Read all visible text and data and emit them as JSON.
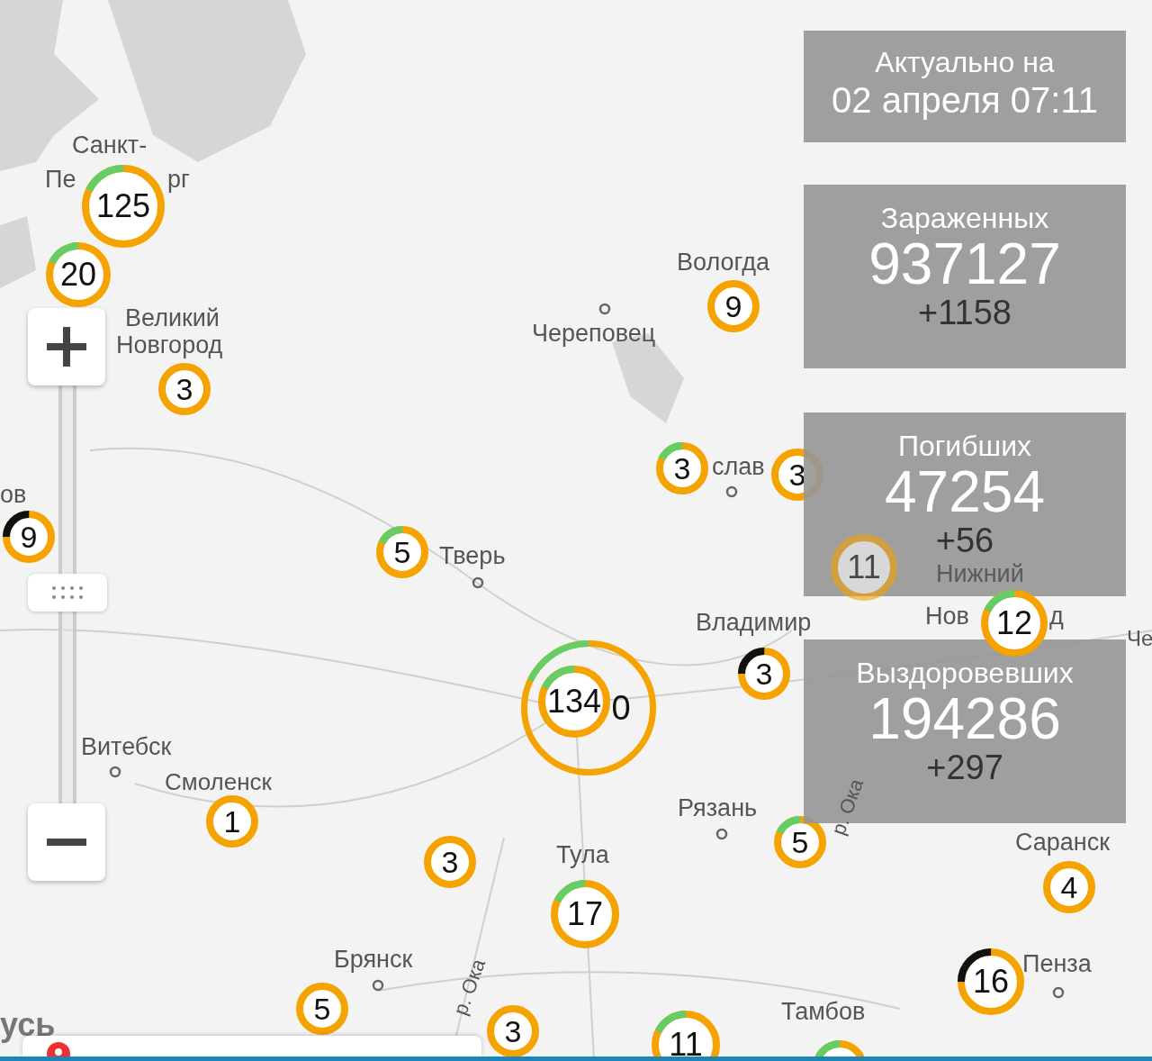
{
  "updated": {
    "label": "Актуально на",
    "datetime": "02 апреля 07:11"
  },
  "stats": [
    {
      "title": "Зараженных",
      "value": "937127",
      "delta": "+1158"
    },
    {
      "title": "Погибших",
      "value": "47254",
      "delta": "+56"
    },
    {
      "title": "Выздоровевших",
      "value": "194286",
      "delta": "+297"
    }
  ],
  "cities": [
    {
      "name": "Санкт-"
    },
    {
      "name": "Пе"
    },
    {
      "name": "рг"
    },
    {
      "name": "Великий"
    },
    {
      "name": "Новгород"
    },
    {
      "name": "Вологда"
    },
    {
      "name": "Череповец"
    },
    {
      "name": "ов"
    },
    {
      "name": "слав"
    },
    {
      "name": "Тверь"
    },
    {
      "name": "Владимир"
    },
    {
      "name": "Нижний"
    },
    {
      "name": "Нов"
    },
    {
      "name": "д"
    },
    {
      "name": "Че"
    },
    {
      "name": "Витебск"
    },
    {
      "name": "Смоленск"
    },
    {
      "name": "Рязань"
    },
    {
      "name": "Тула"
    },
    {
      "name": "Саранск"
    },
    {
      "name": "Брянск"
    },
    {
      "name": "Пенза"
    },
    {
      "name": "Тамбов"
    },
    {
      "name": "р. Ока"
    },
    {
      "name": "р. Ока"
    },
    {
      "name": "усь"
    }
  ],
  "clusters": [
    {
      "count": "125",
      "kind": "mixed"
    },
    {
      "count": "20",
      "kind": "mixed"
    },
    {
      "count": "3",
      "kind": "plain"
    },
    {
      "count": "9",
      "kind": "plain"
    },
    {
      "count": "3",
      "kind": "mixed"
    },
    {
      "count": "3",
      "kind": "plain"
    },
    {
      "count": "9",
      "kind": "dark"
    },
    {
      "count": "5",
      "kind": "mixed"
    },
    {
      "count": "0",
      "kind": "mixed"
    },
    {
      "count": "134",
      "kind": "mixed"
    },
    {
      "count": "3",
      "kind": "dark"
    },
    {
      "count": "11",
      "kind": "plain"
    },
    {
      "count": "12",
      "kind": "mixed"
    },
    {
      "count": "1",
      "kind": "plain"
    },
    {
      "count": "3",
      "kind": "plain"
    },
    {
      "count": "17",
      "kind": "mixed"
    },
    {
      "count": "5",
      "kind": "mixed"
    },
    {
      "count": "4",
      "kind": "plain"
    },
    {
      "count": "16",
      "kind": "dark"
    },
    {
      "count": "5",
      "kind": "plain"
    },
    {
      "count": "3",
      "kind": "plain"
    },
    {
      "count": "11",
      "kind": "mixed"
    },
    {
      "kind": "mixed"
    }
  ]
}
